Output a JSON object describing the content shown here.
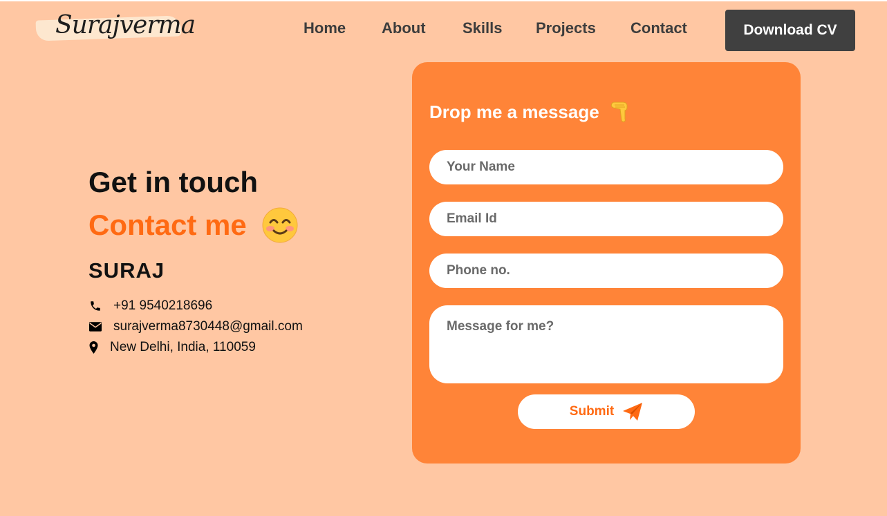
{
  "header": {
    "logo_text": "Surajverma",
    "nav": [
      {
        "label": "Home"
      },
      {
        "label": "About"
      },
      {
        "label": "Skills"
      },
      {
        "label": "Projects"
      },
      {
        "label": "Contact"
      }
    ],
    "cta_label": "Download CV"
  },
  "contact_info": {
    "heading": "Get in touch",
    "subheading": "Contact me",
    "subheading_emoji": "smiling-face-icon",
    "name": "SURAJ",
    "phone": "+91 9540218696",
    "email": "surajverma8730448@gmail.com",
    "address": "New Delhi, India, 110059"
  },
  "form": {
    "title": "Drop me a message",
    "title_icon": "pointing-down-hand-icon",
    "name_placeholder": "Your Name",
    "email_placeholder": "Email Id",
    "phone_placeholder": "Phone no.",
    "message_placeholder": "Message for me?",
    "submit_label": "Submit",
    "submit_icon": "paper-plane-icon"
  },
  "colors": {
    "background": "#ffc7a3",
    "card": "#ff8438",
    "accent": "#ff6a13",
    "cta_bg": "#404040"
  }
}
